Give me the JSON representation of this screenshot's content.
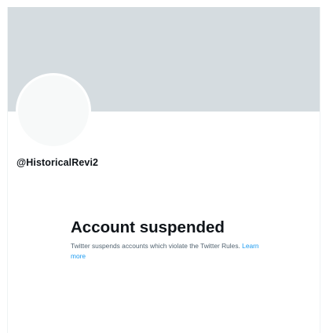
{
  "profile": {
    "handle": "@HistoricalRevi2"
  },
  "suspension": {
    "title": "Account suspended",
    "description": "Twitter suspends accounts which violate the Twitter Rules.",
    "learn_more_label": "Learn more"
  },
  "colors": {
    "banner": "#d5dce0",
    "avatar": "#f7f9f9",
    "text_primary": "#0f1419",
    "text_secondary": "#536471",
    "link": "#1d9bf0"
  }
}
